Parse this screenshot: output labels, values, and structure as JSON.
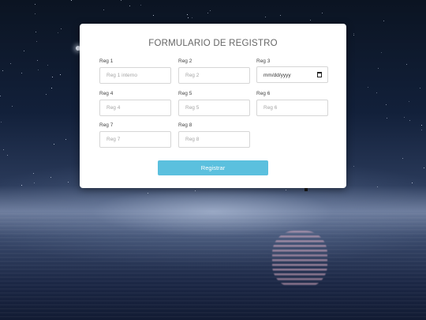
{
  "form": {
    "title": "FORMULARIO DE REGISTRO",
    "fields": [
      {
        "label": "Reg 1",
        "placeholder": "Reg 1 interno"
      },
      {
        "label": "Reg 2",
        "placeholder": "Reg 2"
      },
      {
        "label": "Reg 3",
        "value": "mm/dd/yyyy"
      },
      {
        "label": "Reg 4",
        "placeholder": "Reg 4"
      },
      {
        "label": "Reg 5",
        "placeholder": "Reg 5"
      },
      {
        "label": "Reg 6",
        "placeholder": "Reg 6"
      },
      {
        "label": "Reg 7",
        "placeholder": "Reg 7"
      },
      {
        "label": "Reg 8",
        "placeholder": "Reg 8"
      }
    ],
    "submit_label": "Registrar",
    "accent_color": "#5bc0de"
  }
}
